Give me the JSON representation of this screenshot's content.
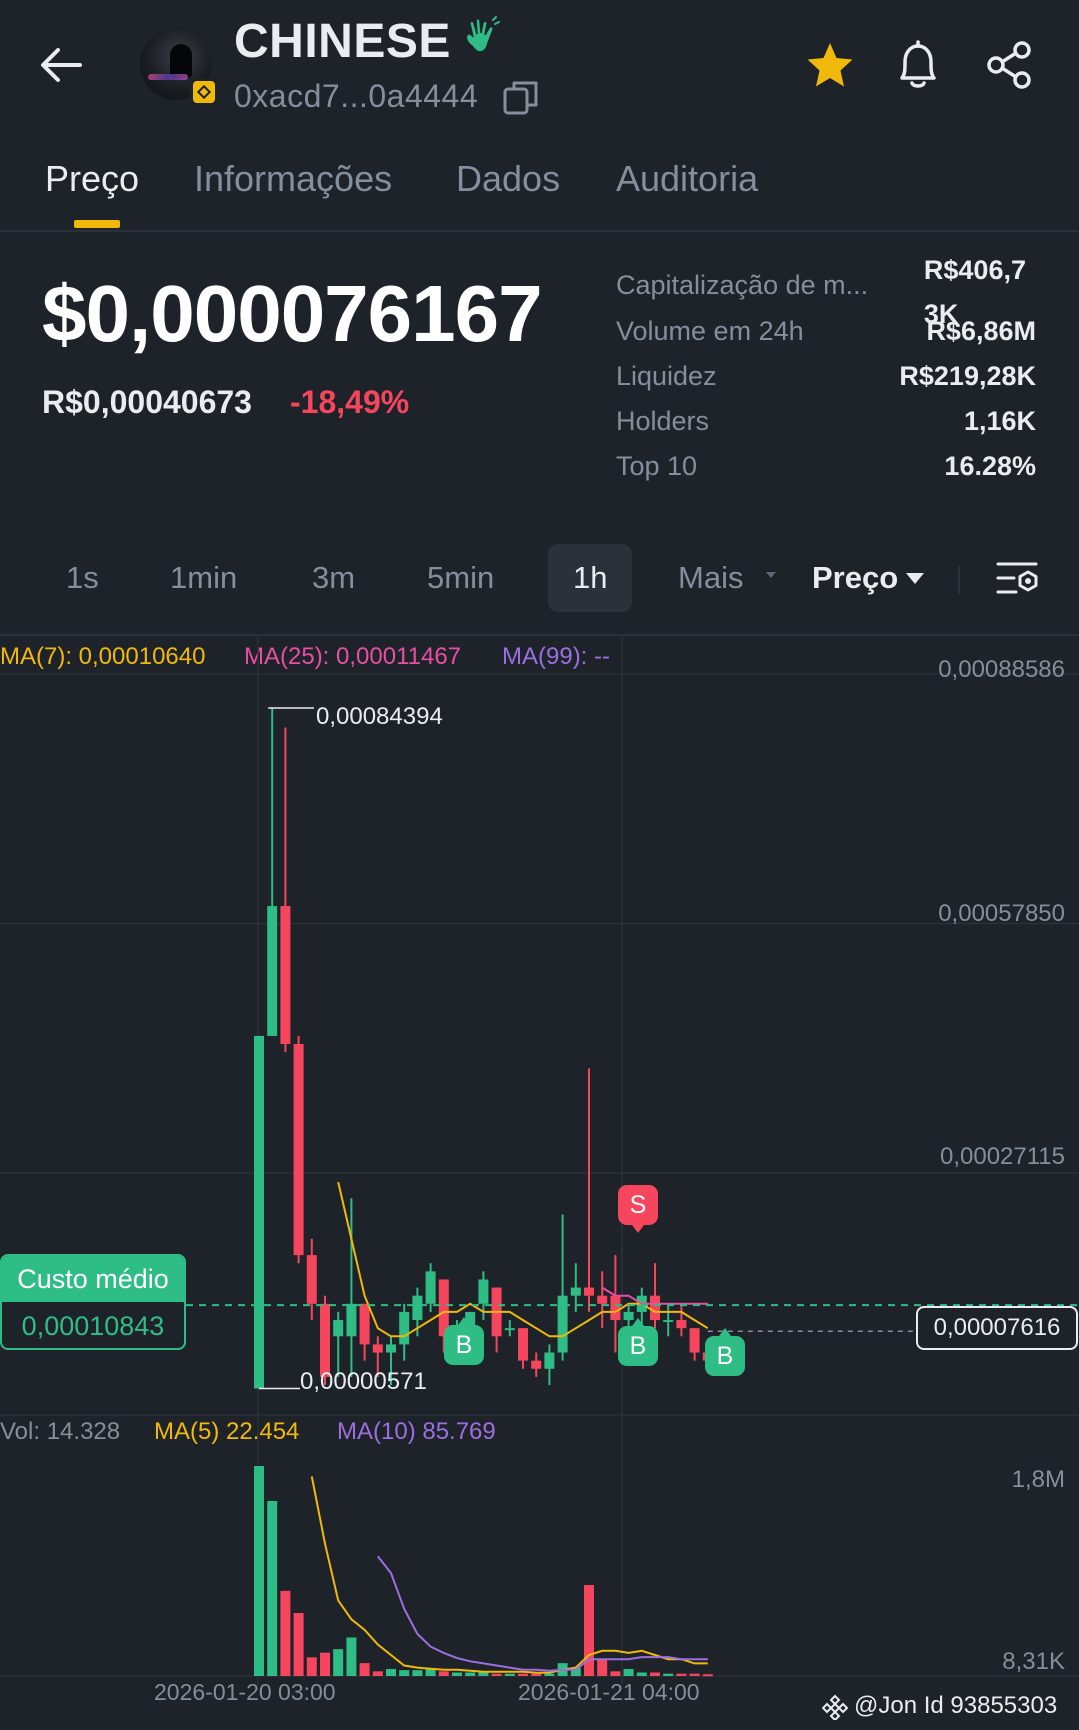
{
  "header": {
    "token_name": "CHINESE",
    "address": "0xacd7...0a4444",
    "icons": [
      "back-arrow-icon",
      "token-avatar",
      "bnb-chain-icon",
      "waving-hand-icon",
      "copy-icon",
      "star-icon",
      "bell-icon",
      "share-icon"
    ],
    "favorite_color": "#f0b90b"
  },
  "tabs": [
    {
      "label": "Preço",
      "active": true
    },
    {
      "label": "Informações",
      "active": false
    },
    {
      "label": "Dados",
      "active": false
    },
    {
      "label": "Auditoria",
      "active": false
    }
  ],
  "price": {
    "usd": "$0,000076167",
    "brl": "R$0,00040673",
    "change": "-18,49%",
    "change_color": "#f6465d"
  },
  "stats": [
    {
      "label": "Capitalização de m...",
      "value": "R$406,7\n3K"
    },
    {
      "label": "Volume em 24h",
      "value": "R$6,86M"
    },
    {
      "label": "Liquidez",
      "value": "R$219,28K"
    },
    {
      "label": "Holders",
      "value": "1,16K"
    },
    {
      "label": "Top 10",
      "value": "16.28%"
    }
  ],
  "intervals": [
    {
      "label": "1s",
      "active": false
    },
    {
      "label": "1min",
      "active": false
    },
    {
      "label": "3m",
      "active": false
    },
    {
      "label": "5min",
      "active": false
    },
    {
      "label": "1h",
      "active": true
    },
    {
      "label": "Mais",
      "active": false
    }
  ],
  "chart_mode": "Preço",
  "chart_data": {
    "type": "candlestick",
    "ma_legend": [
      {
        "label": "MA(7): 0,00010640",
        "color": "#f0b90b"
      },
      {
        "label": "MA(25): 0,00011467",
        "color": "#e84fa4"
      },
      {
        "label": "MA(99): --",
        "color": "#9c6fe0"
      }
    ],
    "y_ticks": [
      "0,00088586",
      "0,00057850",
      "0,00027115"
    ],
    "y_tick_values": [
      0.00088586,
      0.0005785,
      0.00027115
    ],
    "high_label": "0,00084394",
    "low_label": "0,00000571",
    "high": 0.00084394,
    "low": 5.71e-06,
    "last_price": "0,00007616",
    "last_price_value": 7.616e-05,
    "average_cost": {
      "label": "Custo médio",
      "value": "0,00010843",
      "value_num": 0.00010843,
      "color": "#2ebd85"
    },
    "candles": [
      {
        "o": 5.71e-06,
        "h": 0.00044,
        "l": 5.71e-06,
        "c": 0.00044
      },
      {
        "o": 0.00044,
        "h": 0.00084394,
        "l": 0.00044,
        "c": 0.0006
      },
      {
        "o": 0.0006,
        "h": 0.00082,
        "l": 0.00042,
        "c": 0.00043
      },
      {
        "o": 0.00043,
        "h": 0.00044,
        "l": 0.00016,
        "c": 0.00017
      },
      {
        "o": 0.00017,
        "h": 0.00019,
        "l": 9e-05,
        "c": 0.00011
      },
      {
        "o": 0.00011,
        "h": 0.00012,
        "l": 1e-05,
        "c": 2e-05
      },
      {
        "o": 7e-05,
        "h": 0.0001,
        "l": 2e-05,
        "c": 9e-05
      },
      {
        "o": 7e-05,
        "h": 0.00024,
        "l": 2e-05,
        "c": 0.00011
      },
      {
        "o": 0.00011,
        "h": 0.00011,
        "l": 4e-05,
        "c": 6e-05
      },
      {
        "o": 6e-05,
        "h": 7e-05,
        "l": 2e-05,
        "c": 5e-05
      },
      {
        "o": 5e-05,
        "h": 7e-05,
        "l": 1e-05,
        "c": 6e-05
      },
      {
        "o": 6e-05,
        "h": 0.00011,
        "l": 4e-05,
        "c": 0.0001
      },
      {
        "o": 9e-05,
        "h": 0.00013,
        "l": 7e-05,
        "c": 0.00012
      },
      {
        "o": 0.00011,
        "h": 0.00016,
        "l": 0.0001,
        "c": 0.00015
      },
      {
        "o": 0.00014,
        "h": 0.00014,
        "l": 5e-05,
        "c": 7e-05
      },
      {
        "o": 7e-05,
        "h": 9e-05,
        "l": 4e-05,
        "c": 8e-05
      },
      {
        "o": 8e-05,
        "h": 0.0001,
        "l": 6e-05,
        "c": 0.0001
      },
      {
        "o": 0.00011,
        "h": 0.00015,
        "l": 9e-05,
        "c": 0.00014
      },
      {
        "o": 0.00013,
        "h": 0.00013,
        "l": 5e-05,
        "c": 7e-05
      },
      {
        "o": 8e-05,
        "h": 9e-05,
        "l": 7e-05,
        "c": 8e-05
      },
      {
        "o": 8e-05,
        "h": 8e-05,
        "l": 3e-05,
        "c": 4e-05
      },
      {
        "o": 4e-05,
        "h": 5e-05,
        "l": 2e-05,
        "c": 3e-05
      },
      {
        "o": 3e-05,
        "h": 6e-05,
        "l": 1e-05,
        "c": 5e-05
      },
      {
        "o": 5e-05,
        "h": 0.00022,
        "l": 4e-05,
        "c": 0.00012
      },
      {
        "o": 0.00012,
        "h": 0.00016,
        "l": 0.0001,
        "c": 0.00013
      },
      {
        "o": 0.00013,
        "h": 0.0004,
        "l": 0.0001,
        "c": 0.00012
      },
      {
        "o": 0.00012,
        "h": 0.00015,
        "l": 8e-05,
        "c": 0.00011
      },
      {
        "o": 0.00012,
        "h": 0.00017,
        "l": 5e-05,
        "c": 9e-05
      },
      {
        "o": 9e-05,
        "h": 0.00011,
        "l": 5e-05,
        "c": 0.0001
      },
      {
        "o": 0.0001,
        "h": 0.00013,
        "l": 7e-05,
        "c": 0.00012
      },
      {
        "o": 0.00012,
        "h": 0.00016,
        "l": 8e-05,
        "c": 9e-05
      },
      {
        "o": 9e-05,
        "h": 0.00011,
        "l": 7e-05,
        "c": 9e-05
      },
      {
        "o": 9e-05,
        "h": 0.00011,
        "l": 7e-05,
        "c": 8e-05
      },
      {
        "o": 8e-05,
        "h": 8e-05,
        "l": 4e-05,
        "c": 5e-05
      },
      {
        "o": 5e-05,
        "h": 5e-05,
        "l": 3e-05,
        "c": 4e-05
      }
    ],
    "ma7": [
      null,
      null,
      null,
      null,
      null,
      null,
      0.00026,
      0.00019,
      0.00012,
      8e-05,
      7e-05,
      7e-05,
      8e-05,
      9e-05,
      0.0001,
      0.0001,
      0.00011,
      0.0001,
      0.0001,
      0.0001,
      9e-05,
      8e-05,
      7e-05,
      7e-05,
      8e-05,
      9e-05,
      0.0001,
      0.0001,
      0.00011,
      0.00011,
      0.0001,
      0.0001,
      0.0001,
      9e-05,
      8e-05
    ],
    "ma25": [
      null,
      null,
      null,
      null,
      null,
      null,
      null,
      null,
      null,
      null,
      null,
      null,
      null,
      null,
      null,
      null,
      null,
      null,
      null,
      null,
      null,
      null,
      null,
      null,
      null,
      null,
      0.00013,
      0.00012,
      0.00012,
      0.00011,
      0.00011,
      0.00011,
      0.00011,
      0.00011,
      0.00011
    ],
    "trade_markers": [
      {
        "label": "B",
        "side": "buy",
        "candle": 14
      },
      {
        "label": "S",
        "side": "sell",
        "candle": 26
      },
      {
        "label": "B",
        "side": "buy",
        "candle": 26
      },
      {
        "label": "B",
        "side": "buy",
        "candle": 33
      }
    ],
    "volume_legend": [
      {
        "label": "Vol: 14.328",
        "color": "#848e9c"
      },
      {
        "label": "MA(5) 22.454",
        "color": "#f0b90b"
      },
      {
        "label": "MA(10) 85.769",
        "color": "#9c6fe0"
      }
    ],
    "volume_ticks": [
      "1,8M",
      "8,31K"
    ],
    "volumes": [
      1800000,
      1500000,
      730000,
      540000,
      160000,
      200000,
      230000,
      330000,
      110000,
      40000,
      60000,
      50000,
      50000,
      60000,
      40000,
      30000,
      30000,
      30000,
      20000,
      20000,
      20000,
      20000,
      20000,
      110000,
      70000,
      780000,
      140000,
      40000,
      60000,
      30000,
      30000,
      20000,
      20000,
      20000,
      15000
    ],
    "volume_max": 1800000,
    "vol_ma5": [
      null,
      null,
      null,
      null,
      0.95,
      0.63,
      0.36,
      0.27,
      0.22,
      0.15,
      0.1,
      0.05,
      0.04,
      0.035,
      0.03,
      0.03,
      0.025,
      0.02,
      0.02,
      0.02,
      0.02,
      0.015,
      0.015,
      0.03,
      0.04,
      0.1,
      0.12,
      0.12,
      0.11,
      0.12,
      0.1,
      0.08,
      0.08,
      0.06,
      0.06
    ],
    "vol_ma10": [
      null,
      null,
      null,
      null,
      null,
      null,
      null,
      null,
      null,
      0.57,
      0.49,
      0.32,
      0.2,
      0.14,
      0.11,
      0.085,
      0.07,
      0.06,
      0.05,
      0.04,
      0.03,
      0.03,
      0.025,
      0.03,
      0.03,
      0.08,
      0.08,
      0.08,
      0.08,
      0.09,
      0.09,
      0.09,
      0.08,
      0.08,
      0.08
    ],
    "x_ticks": [
      "2026-01-20 03:00",
      "2026-01-21 04:00"
    ],
    "up_color": "#2ebd85",
    "down_color": "#f6465d"
  },
  "watermark": "@Jon Id 93855303"
}
